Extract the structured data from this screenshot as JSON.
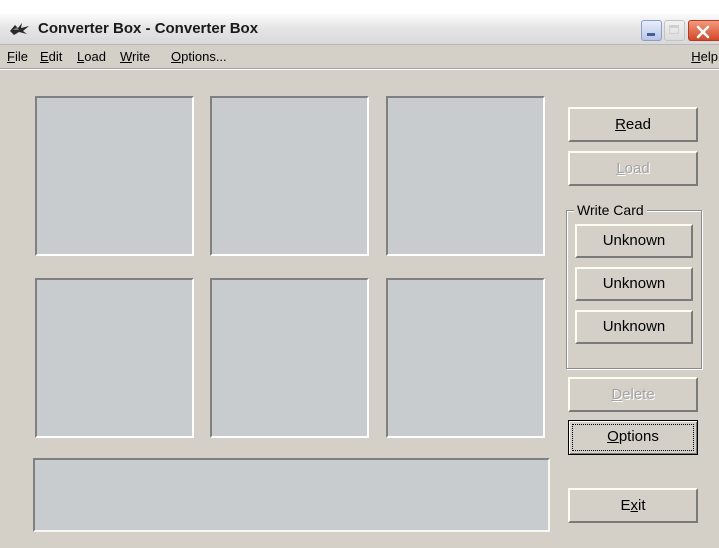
{
  "window": {
    "title": "Converter Box - Converter Box"
  },
  "menu": {
    "file": {
      "hotkey": "F",
      "rest": "ile"
    },
    "edit": {
      "hotkey": "E",
      "rest": "dit"
    },
    "load": {
      "hotkey": "L",
      "rest": "oad"
    },
    "write": {
      "hotkey": "W",
      "rest": "rite"
    },
    "options": {
      "hotkey": "O",
      "rest": "ptions..."
    },
    "help": {
      "hotkey": "H",
      "rest": "elp"
    }
  },
  "buttons": {
    "read": {
      "hotkey": "R",
      "rest": "ead"
    },
    "load": {
      "hotkey": "L",
      "rest": "oad"
    },
    "delete": {
      "hotkey": "D",
      "rest": "elete"
    },
    "options": {
      "hotkey": "O",
      "rest": "ptions"
    },
    "exit": {
      "pre": "E",
      "hotkey": "x",
      "rest": "it"
    }
  },
  "write_card": {
    "legend": "Write Card",
    "slots": [
      "Unknown",
      "Unknown",
      "Unknown"
    ]
  },
  "status_text": ""
}
